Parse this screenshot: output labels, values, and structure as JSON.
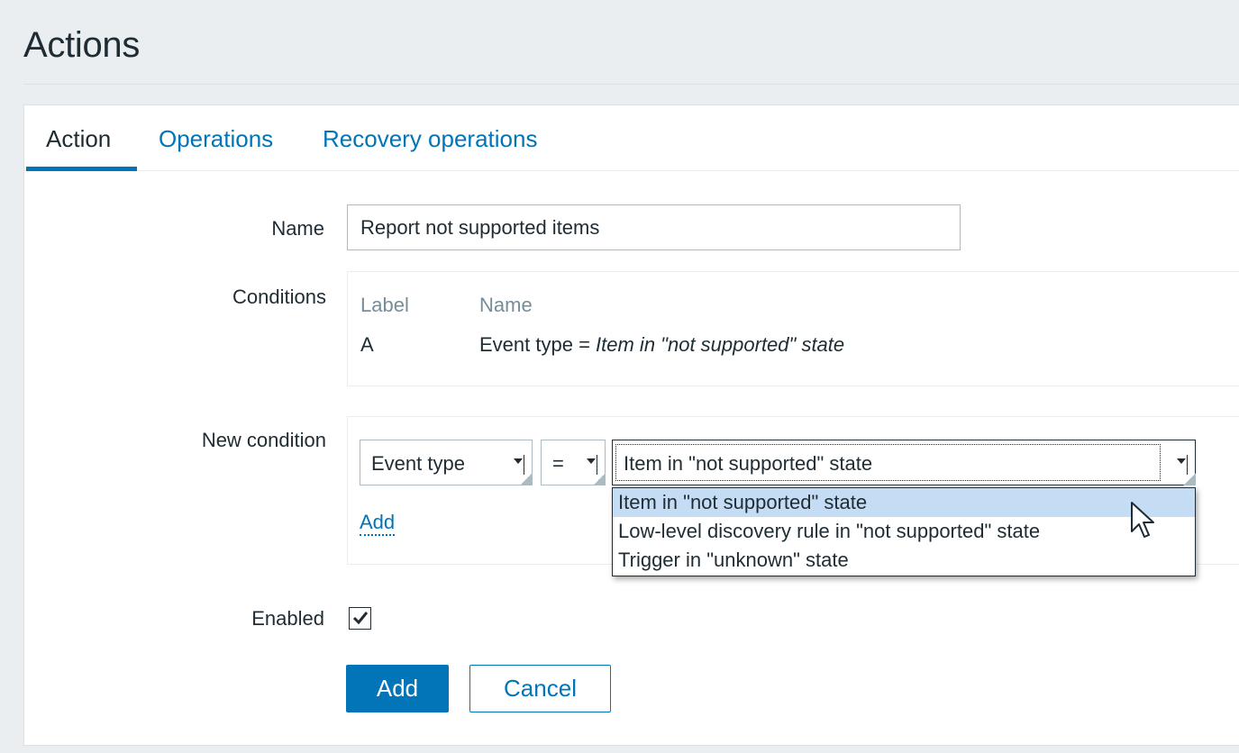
{
  "page": {
    "title": "Actions"
  },
  "tabs": [
    {
      "label": "Action"
    },
    {
      "label": "Operations"
    },
    {
      "label": "Recovery operations"
    }
  ],
  "form": {
    "name_label": "Name",
    "name_value": "Report not supported items",
    "conditions_label": "Conditions",
    "conditions": {
      "headers": [
        "Label",
        "Name"
      ],
      "rows": [
        {
          "label": "A",
          "name_prefix": "Event type = ",
          "name_value": "Item in \"not supported\" state"
        }
      ]
    },
    "new_condition_label": "New condition",
    "new_condition": {
      "type_value": "Event type",
      "operator_value": "=",
      "value_selected": "Item in \"not supported\" state",
      "value_options": [
        "Item in \"not supported\" state",
        "Low-level discovery rule in \"not supported\" state",
        "Trigger in \"unknown\" state"
      ],
      "add_link": "Add"
    },
    "enabled_label": "Enabled",
    "enabled_checked": true
  },
  "buttons": {
    "add": "Add",
    "cancel": "Cancel"
  },
  "colors": {
    "accent": "#0275b8",
    "highlight": "#c5dcf5",
    "background": "#ebeef0"
  }
}
